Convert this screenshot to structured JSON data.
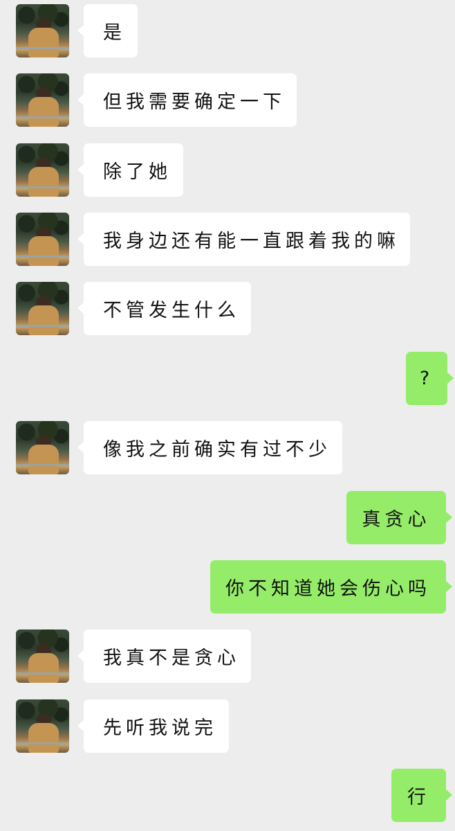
{
  "colors": {
    "background": "#ededed",
    "incoming_bubble": "#ffffff",
    "outgoing_bubble": "#95ec69"
  },
  "messages": [
    {
      "sender": "other",
      "text": "是"
    },
    {
      "sender": "other",
      "text": "但我需要确定一下"
    },
    {
      "sender": "other",
      "text": "除了她"
    },
    {
      "sender": "other",
      "text": "我身边还有能一直跟着我的嘛"
    },
    {
      "sender": "other",
      "text": "不管发生什么"
    },
    {
      "sender": "self",
      "text": "?"
    },
    {
      "sender": "other",
      "text": "像我之前确实有过不少"
    },
    {
      "sender": "self",
      "text": "真贪心"
    },
    {
      "sender": "self",
      "text": "你不知道她会伤心吗"
    },
    {
      "sender": "other",
      "text": "我真不是贪心"
    },
    {
      "sender": "other",
      "text": "先听我说完"
    },
    {
      "sender": "self",
      "text": "行"
    }
  ]
}
